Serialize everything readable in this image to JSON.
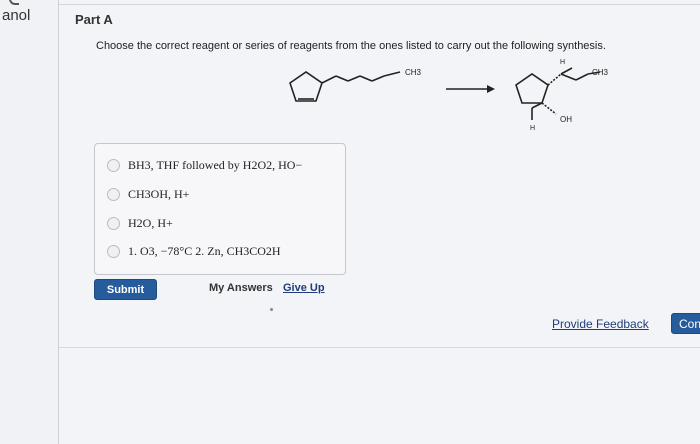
{
  "sidebar": {
    "tab_text": "anol"
  },
  "part": {
    "title": "Part A"
  },
  "question": {
    "prompt": "Choose the correct reagent or series of reagents from the ones listed to carry out the following synthesis.",
    "reactant_label": "CH3",
    "product_labels": {
      "ch3": "CH3",
      "oh": "OH",
      "h_top": "H",
      "h_bottom": "H"
    }
  },
  "options": [
    {
      "label": "BH3, THF followed by H2O2, HO−"
    },
    {
      "label": "CH3OH, H+"
    },
    {
      "label": "H2O, H+"
    },
    {
      "label": "1. O3, −78°C 2. Zn, CH3CO2H"
    }
  ],
  "actions": {
    "submit_label": "Submit",
    "my_answers_label": "My Answers",
    "give_up_label": "Give Up",
    "feedback_label": "Provide Feedback",
    "continue_label": "Continue"
  },
  "colors": {
    "accent": "#265b9c",
    "link": "#1f3d7a"
  }
}
